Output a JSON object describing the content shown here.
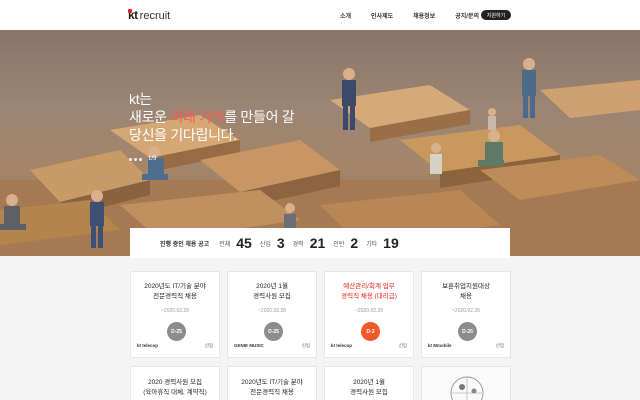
{
  "header": {
    "logo_kt": "kt",
    "logo_text": "recruit",
    "nav": [
      "소개",
      "인사제도",
      "채용정보",
      "공지/문의"
    ],
    "nav_button": "지원하기"
  },
  "hero": {
    "line1": "kt는",
    "line2_pre": "새로운 ",
    "line2_accent": "미래 가치",
    "line2_post": "를 만들어 갈",
    "line3": "당신을 기다립니다.",
    "pager": "1/3"
  },
  "stats": {
    "label": "진행 중인 채용 공고",
    "items": [
      {
        "name": "전체",
        "value": "45"
      },
      {
        "name": "신입",
        "value": "3"
      },
      {
        "name": "경력",
        "value": "21"
      },
      {
        "name": "인턴",
        "value": "2"
      },
      {
        "name": "기타",
        "value": "19"
      }
    ]
  },
  "cards": [
    {
      "title1": "2020년도 IT/기술 분야",
      "title2": "전문경력직 채용",
      "date": "~2020.02.29",
      "dday": "D-25",
      "company": "kt telecop",
      "type": "신입",
      "highlight": false
    },
    {
      "title1": "2020년 1월",
      "title2": "경력사원 모집",
      "date": "~2020.02.28",
      "dday": "D-25",
      "company": "GENIE MUSIC",
      "type": "신입",
      "highlight": false
    },
    {
      "title1": "예산관리/회계 업무",
      "title2": "경력직 채용 (대리급)",
      "date": "~2020.02.29",
      "dday": "D-3",
      "company": "kt telecop",
      "type": "신입",
      "highlight": true
    },
    {
      "title1": "보훈취업지원대상",
      "title2": "채용",
      "date": "~2020.02.28",
      "dday": "D-25",
      "company": "kt Mmobile",
      "type": "신입",
      "highlight": false
    }
  ],
  "cards_row2": [
    {
      "title1": "2020 경력사원 모집",
      "title2": "(육아휴직 대체, 계약직)"
    },
    {
      "title1": "2020년도 IT/기술 분야",
      "title2": "전문경력직 채용"
    },
    {
      "title1": "2020년 1월",
      "title2": "경력사원 모집"
    }
  ],
  "colors": {
    "accent": "#e2231a",
    "dday_urgent": "#f05a28",
    "dday_normal": "#8c8c8c"
  }
}
